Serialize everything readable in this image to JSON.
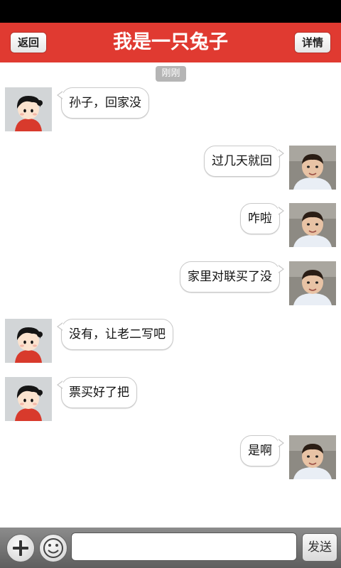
{
  "header": {
    "back_label": "返回",
    "title": "我是一只兔子",
    "details_label": "详情",
    "bg_color": "#e03a31"
  },
  "chat": {
    "time_label": "刚刚",
    "messages": [
      {
        "side": "left",
        "text": "孙子，回家没",
        "avatar": "cartoon-boy-avatar"
      },
      {
        "side": "right",
        "text": "过几天就回",
        "avatar": "child-photo-avatar"
      },
      {
        "side": "right",
        "text": "咋啦",
        "avatar": "child-photo-avatar"
      },
      {
        "side": "right",
        "text": "家里对联买了没",
        "avatar": "child-photo-avatar"
      },
      {
        "side": "left",
        "text": "没有，让老二写吧",
        "avatar": "cartoon-boy-avatar"
      },
      {
        "side": "left",
        "text": "票买好了把",
        "avatar": "cartoon-boy-avatar"
      },
      {
        "side": "right",
        "text": "是啊",
        "avatar": "child-photo-avatar"
      }
    ]
  },
  "composer": {
    "input_value": "",
    "send_label": "发送",
    "add_icon": "plus-icon",
    "emoji_icon": "smiley-icon"
  }
}
